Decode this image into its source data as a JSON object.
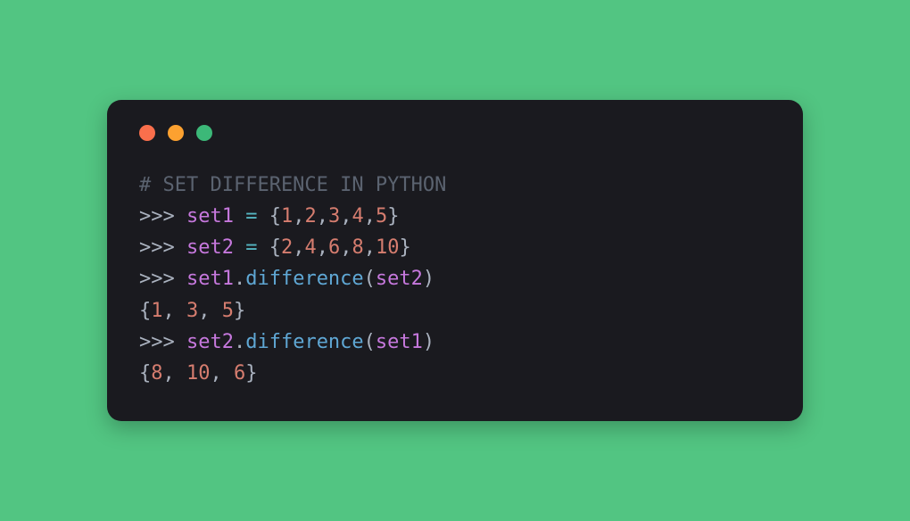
{
  "window": {
    "traffic_red": "close",
    "traffic_orange": "minimize",
    "traffic_green": "maximize"
  },
  "code": {
    "lines": [
      {
        "tokens": [
          {
            "cls": "comment",
            "text": "# SET DIFFERENCE IN PYTHON"
          }
        ]
      },
      {
        "tokens": [
          {
            "cls": "prompt",
            "text": ">>> "
          },
          {
            "cls": "identifier",
            "text": "set1"
          },
          {
            "cls": "prompt",
            "text": " "
          },
          {
            "cls": "operator",
            "text": "="
          },
          {
            "cls": "prompt",
            "text": " "
          },
          {
            "cls": "brace",
            "text": "{"
          },
          {
            "cls": "number",
            "text": "1"
          },
          {
            "cls": "comma",
            "text": ","
          },
          {
            "cls": "number",
            "text": "2"
          },
          {
            "cls": "comma",
            "text": ","
          },
          {
            "cls": "number",
            "text": "3"
          },
          {
            "cls": "comma",
            "text": ","
          },
          {
            "cls": "number",
            "text": "4"
          },
          {
            "cls": "comma",
            "text": ","
          },
          {
            "cls": "number",
            "text": "5"
          },
          {
            "cls": "brace",
            "text": "}"
          }
        ]
      },
      {
        "tokens": [
          {
            "cls": "prompt",
            "text": ">>> "
          },
          {
            "cls": "identifier",
            "text": "set2"
          },
          {
            "cls": "prompt",
            "text": " "
          },
          {
            "cls": "operator",
            "text": "="
          },
          {
            "cls": "prompt",
            "text": " "
          },
          {
            "cls": "brace",
            "text": "{"
          },
          {
            "cls": "number",
            "text": "2"
          },
          {
            "cls": "comma",
            "text": ","
          },
          {
            "cls": "number",
            "text": "4"
          },
          {
            "cls": "comma",
            "text": ","
          },
          {
            "cls": "number",
            "text": "6"
          },
          {
            "cls": "comma",
            "text": ","
          },
          {
            "cls": "number",
            "text": "8"
          },
          {
            "cls": "comma",
            "text": ","
          },
          {
            "cls": "number",
            "text": "10"
          },
          {
            "cls": "brace",
            "text": "}"
          }
        ]
      },
      {
        "tokens": [
          {
            "cls": "prompt",
            "text": ">>> "
          },
          {
            "cls": "identifier",
            "text": "set1"
          },
          {
            "cls": "dot",
            "text": "."
          },
          {
            "cls": "method",
            "text": "difference"
          },
          {
            "cls": "paren",
            "text": "("
          },
          {
            "cls": "identifier",
            "text": "set2"
          },
          {
            "cls": "paren",
            "text": ")"
          }
        ]
      },
      {
        "tokens": [
          {
            "cls": "brace",
            "text": "{"
          },
          {
            "cls": "number",
            "text": "1"
          },
          {
            "cls": "comma",
            "text": ", "
          },
          {
            "cls": "number",
            "text": "3"
          },
          {
            "cls": "comma",
            "text": ", "
          },
          {
            "cls": "number",
            "text": "5"
          },
          {
            "cls": "brace",
            "text": "}"
          }
        ]
      },
      {
        "tokens": [
          {
            "cls": "prompt",
            "text": ">>> "
          },
          {
            "cls": "identifier",
            "text": "set2"
          },
          {
            "cls": "dot",
            "text": "."
          },
          {
            "cls": "method",
            "text": "difference"
          },
          {
            "cls": "paren",
            "text": "("
          },
          {
            "cls": "identifier",
            "text": "set1"
          },
          {
            "cls": "paren",
            "text": ")"
          }
        ]
      },
      {
        "tokens": [
          {
            "cls": "brace",
            "text": "{"
          },
          {
            "cls": "number",
            "text": "8"
          },
          {
            "cls": "comma",
            "text": ", "
          },
          {
            "cls": "number",
            "text": "10"
          },
          {
            "cls": "comma",
            "text": ", "
          },
          {
            "cls": "number",
            "text": "6"
          },
          {
            "cls": "brace",
            "text": "}"
          }
        ]
      }
    ]
  }
}
